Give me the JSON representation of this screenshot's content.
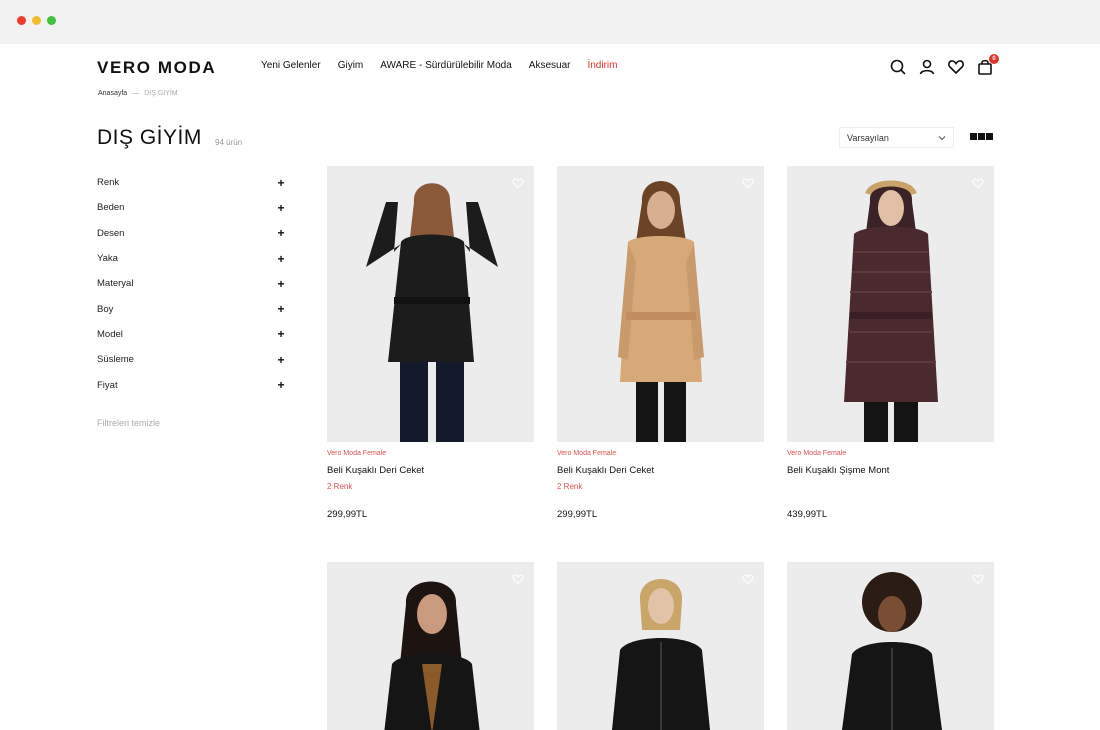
{
  "header": {
    "logo": "VERO MODA",
    "nav": [
      "Yeni Gelenler",
      "Giyim",
      "AWARE - Sürdürülebilir Moda",
      "Aksesuar",
      "İndirim"
    ],
    "cart_count": "0",
    "icons": [
      "search-icon",
      "user-icon",
      "heart-icon",
      "bag-icon"
    ]
  },
  "breadcrumb": {
    "home": "Anasayfa",
    "separator": "—",
    "current": "DIŞ GİYİM"
  },
  "page": {
    "title": "DIŞ GİYİM",
    "count": "94 ürün",
    "sort_value": "Varsayılan"
  },
  "filters": {
    "items": [
      "Renk",
      "Beden",
      "Desen",
      "Yaka",
      "Materyal",
      "Boy",
      "Model",
      "Süsleme",
      "Fiyat"
    ],
    "clear_label": "Filtreleri temizle"
  },
  "products": [
    {
      "brand": "Vero Moda Female",
      "name": "Beli Kuşaklı Deri Ceket",
      "colors": "2 Renk",
      "price": "299,99TL",
      "swatch": "#1c1c1c"
    },
    {
      "brand": "Vero Moda Female",
      "name": "Beli Kuşaklı Deri Ceket",
      "colors": "2 Renk",
      "price": "299,99TL",
      "swatch": "#d7a878"
    },
    {
      "brand": "Vero Moda Female",
      "name": "Beli Kuşaklı Şişme Mont",
      "colors": "",
      "price": "439,99TL",
      "swatch": "#4a2a2e"
    },
    {
      "brand": "",
      "name": "",
      "colors": "",
      "price": "",
      "swatch": "#151515"
    },
    {
      "brand": "",
      "name": "",
      "colors": "",
      "price": "",
      "swatch": "#151515"
    },
    {
      "brand": "",
      "name": "",
      "colors": "",
      "price": "",
      "swatch": "#151515"
    }
  ],
  "colors": {
    "accent": "#e0342a",
    "image_bg": "#ececec"
  }
}
